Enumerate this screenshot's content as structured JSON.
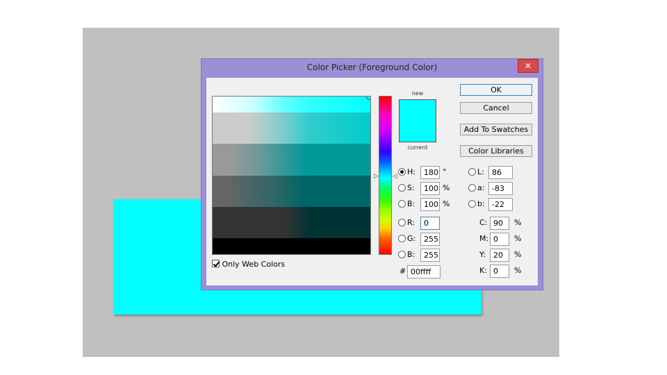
{
  "dialog": {
    "title": "Color Picker (Foreground Color)",
    "close_icon": "close-icon"
  },
  "swatches": {
    "new_label": "new",
    "current_label": "current",
    "new_color": "#00ffff",
    "current_color": "#00ffff"
  },
  "buttons": {
    "ok": "OK",
    "cancel": "Cancel",
    "add_to_swatches": "Add To Swatches",
    "color_libraries": "Color Libraries"
  },
  "hsb": {
    "h_label": "H:",
    "h_value": "180",
    "h_unit": "°",
    "s_label": "S:",
    "s_value": "100",
    "s_unit": "%",
    "b_label": "B:",
    "b_value": "100",
    "b_unit": "%"
  },
  "rgb": {
    "r_label": "R:",
    "r_value": "0",
    "g_label": "G:",
    "g_value": "255",
    "b_label": "B:",
    "b_value": "255"
  },
  "lab": {
    "l_label": "L:",
    "l_value": "86",
    "a_label": "a:",
    "a_value": "-83",
    "b_label": "b:",
    "b_value": "-22"
  },
  "cmyk": {
    "c_label": "C:",
    "c_value": "90",
    "c_unit": "%",
    "m_label": "M:",
    "m_value": "0",
    "m_unit": "%",
    "y_label": "Y:",
    "y_value": "20",
    "y_unit": "%",
    "k_label": "K:",
    "k_value": "0",
    "k_unit": "%"
  },
  "hex": {
    "label": "#",
    "value": "00ffff"
  },
  "options": {
    "only_web_colors": "Only Web Colors",
    "only_web_colors_checked": true
  },
  "selected_mode": "H",
  "colors": {
    "workspace_bg": "#c0c0c0",
    "document_fill": "#00ffff",
    "titlebar": "#9c8fd6",
    "close_button": "#d84a4a"
  }
}
